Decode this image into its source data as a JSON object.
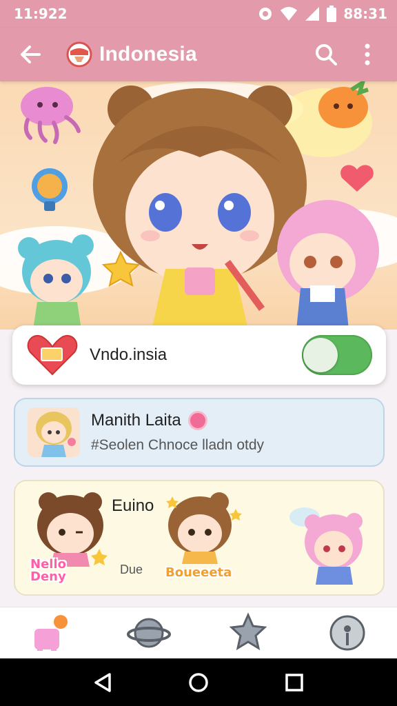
{
  "status_bar": {
    "time": "11:922",
    "clock_right": "88:31",
    "icons": [
      "notification-dot-icon",
      "wifi-icon",
      "signal-icon",
      "battery-icon"
    ]
  },
  "app_bar": {
    "title": "Indonesia",
    "back_icon": "arrow-back-icon",
    "flag_icon": "indonesia-flag-icon",
    "search_icon": "search-icon",
    "menu_icon": "more-vert-icon"
  },
  "toggle_card": {
    "label": "Vndo.insia",
    "icon": "heart-badge-icon",
    "toggle_on": true
  },
  "list_card": {
    "name": "Manith Laita",
    "subtitle": "#Seolen Chnoce lladn otdy",
    "icon": "lollipop-icon"
  },
  "sticker_card": {
    "title": "Euino",
    "caption": "Due",
    "tag_left": "Nello\nDeny",
    "tag_center": "Boueeeta"
  },
  "bottom_nav": {
    "items": [
      "unicorn-icon",
      "planet-icon",
      "star-icon",
      "compass-icon"
    ]
  },
  "system_nav": {
    "items": [
      "back-triangle-icon",
      "home-circle-icon",
      "recents-square-icon"
    ]
  },
  "colors": {
    "accent": "#e39aab",
    "toggle": "#5cb85c",
    "list_card_bg": "#e3eef7",
    "sticker_card_bg": "#fdf9e3"
  }
}
